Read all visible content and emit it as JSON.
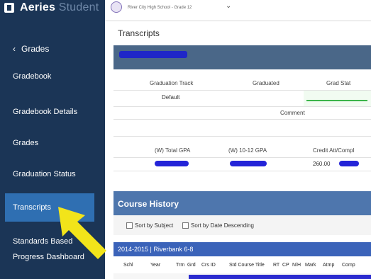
{
  "app": {
    "name": "Aeries",
    "name_suffix": "Student"
  },
  "header": {
    "school_line": "River City High School - Grade 12"
  },
  "sidebar": {
    "back_label": "Grades",
    "items": [
      {
        "label": "Gradebook"
      },
      {
        "label": "Gradebook Details"
      },
      {
        "label": "Grades"
      },
      {
        "label": "Graduation Status"
      },
      {
        "label": "Transcripts",
        "active": true
      },
      {
        "label": "Standards Based Progress Dashboard"
      }
    ]
  },
  "page": {
    "title": "Transcripts"
  },
  "graduation": {
    "headers": {
      "track": "Graduation Track",
      "graduated": "Graduated",
      "grad_status": "Grad Stat"
    },
    "track_value": "Default",
    "comment_label": "Comment"
  },
  "gpa": {
    "headers": {
      "total": "(W) Total GPA",
      "tenth_twelfth": "(W) 10-12 GPA",
      "credits": "Credit Att/Compl"
    },
    "credits_attempted": "260.00"
  },
  "course_history": {
    "title": "Course History",
    "sort_by_subject": "Sort by Subject",
    "sort_by_date": "Sort by Date Descending",
    "term": "2014-2015 | Riverbank 6-8",
    "columns": [
      "Schl",
      "Year",
      "Trm",
      "Grd",
      "Crs ID",
      "Std Course Title",
      "RT",
      "CP",
      "N/H",
      "Mark",
      "Atmp",
      "Comp"
    ]
  },
  "colors": {
    "sidebar_bg": "#1b3556",
    "active_item": "#2f6fb2",
    "panel_header": "#4a6788",
    "course_header": "#4e76ad",
    "term_bar": "#3b63b9",
    "status_line": "#3bb54a",
    "annotation_arrow": "#f2e41a"
  }
}
